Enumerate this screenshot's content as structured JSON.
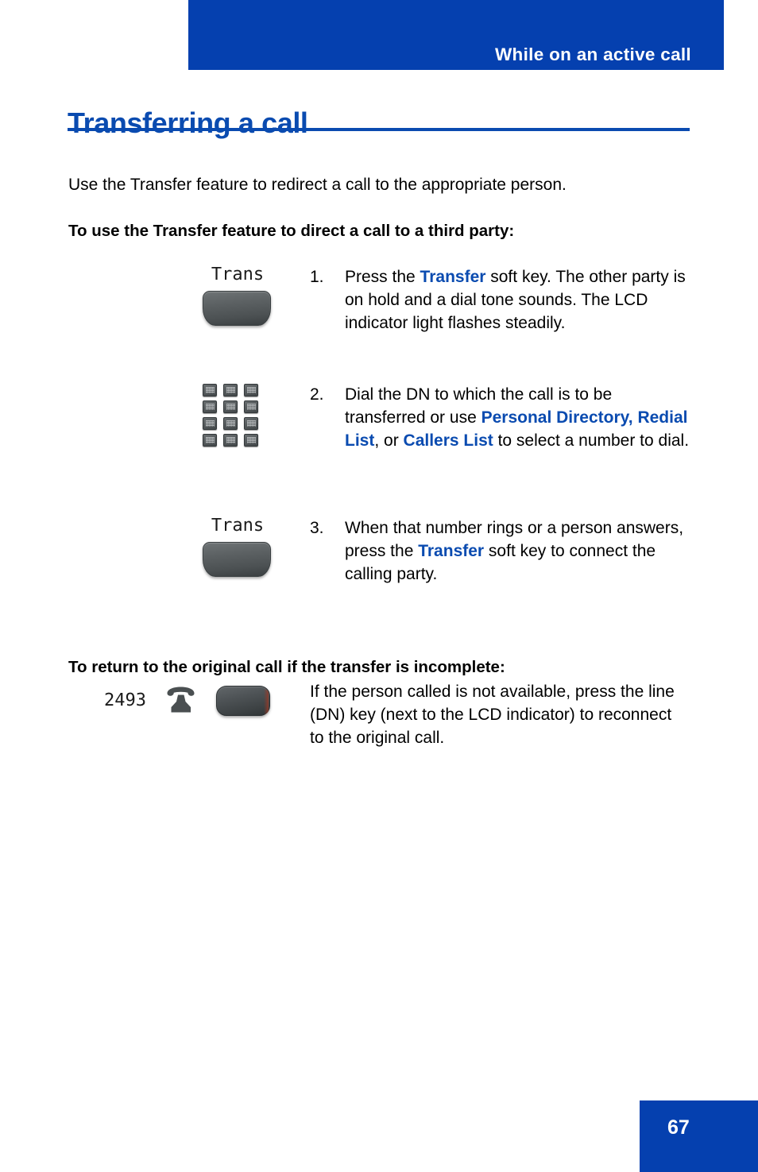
{
  "header": {
    "running_title": "While on an active call",
    "background_color": "#0540af",
    "text_color": "#ffffff"
  },
  "page": {
    "title": "Transferring a call",
    "title_color": "#0a4bb0",
    "intro": "Use the Transfer feature to redirect a call to the appropriate person."
  },
  "section_one": {
    "subheading": "To use the Transfer feature to direct a call to a third party:",
    "steps": [
      {
        "number": "1.",
        "icon": "softkey-trans",
        "icon_label": "Trans",
        "text_parts": [
          {
            "text": "Press the ",
            "style": "normal"
          },
          {
            "text": "Transfer",
            "style": "emphasis"
          },
          {
            "text": " soft key. The other party is on hold and a dial tone sounds. The LCD indicator light flashes steadily.",
            "style": "normal"
          }
        ]
      },
      {
        "number": "2.",
        "icon": "dialpad-keypad",
        "icon_label": "",
        "text_parts": [
          {
            "text": "Dial the DN to which the call is to be transferred or use ",
            "style": "normal"
          },
          {
            "text": "Personal Directory, Redial List",
            "style": "emphasis"
          },
          {
            "text": ", or ",
            "style": "normal"
          },
          {
            "text": "Callers List",
            "style": "emphasis"
          },
          {
            "text": " to select a number to dial.",
            "style": "normal"
          }
        ]
      },
      {
        "number": "3.",
        "icon": "softkey-trans",
        "icon_label": "Trans",
        "text_parts": [
          {
            "text": "When that number rings or a person answers, press the ",
            "style": "normal"
          },
          {
            "text": "Transfer",
            "style": "emphasis"
          },
          {
            "text": " soft key to connect the calling party.",
            "style": "normal"
          }
        ]
      }
    ]
  },
  "section_two": {
    "subheading": "To return to the original call if the transfer is incomplete:",
    "note": {
      "dn_label": "2493",
      "icons": [
        "dn-number-label",
        "telephone-handset-icon",
        "line-dn-key"
      ],
      "text": "If the person called is not available, press the line (DN) key (next to the LCD indicator) to reconnect to the original call."
    }
  },
  "footer": {
    "page_number": "67",
    "background_color": "#0540af",
    "text_color": "#ffffff"
  }
}
